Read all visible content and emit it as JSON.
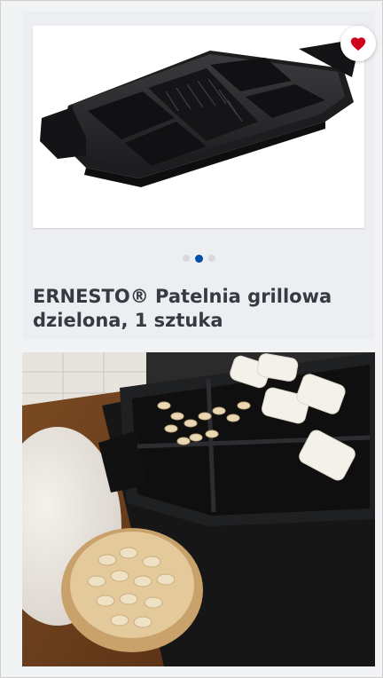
{
  "product": {
    "title": "ERNESTO® Patelnia grillowa dzielona, 1 sztuka",
    "favorite": {
      "active": true,
      "icon": "heart-icon",
      "color": "#d0021b"
    },
    "gallery": {
      "total": 3,
      "active_index": 1,
      "active_color": "#0050aa"
    }
  }
}
